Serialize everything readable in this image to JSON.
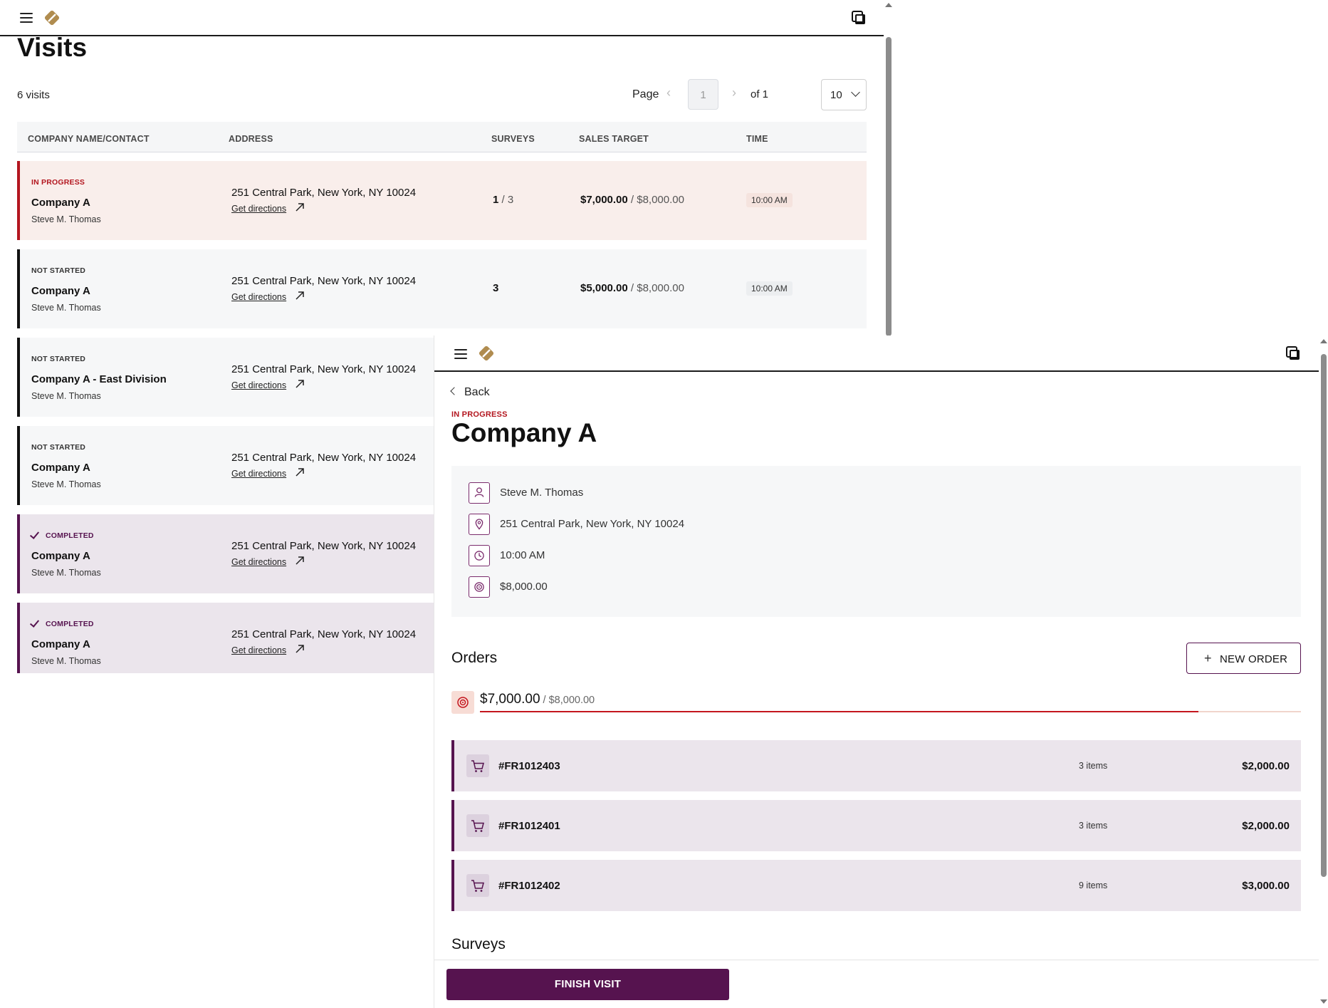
{
  "colors": {
    "brand_purple": "#56134f",
    "in_progress_red": "#b3161f",
    "logo_gold": "#b08c4f"
  },
  "list_view": {
    "title": "Visits",
    "count_text": "6 visits",
    "pagination": {
      "page_label": "Page",
      "current_page": "1",
      "of_text": "of 1",
      "per_page": "10"
    },
    "columns": [
      "COMPANY NAME/CONTACT",
      "ADDRESS",
      "SURVEYS",
      "SALES TARGET",
      "TIME"
    ],
    "rows": [
      {
        "status": "IN PROGRESS",
        "company": "Company A",
        "contact": "Steve M. Thomas",
        "address": "251 Central Park, New York, NY 10024",
        "directions": "Get directions",
        "surveys_done": "1",
        "surveys_total": " / 3",
        "sales_amount": "$7,000.00",
        "sales_target": " / $8,000.00",
        "time": "10:00 AM"
      },
      {
        "status": "NOT STARTED",
        "company": "Company A",
        "contact": "Steve M. Thomas",
        "address": "251 Central Park, New York, NY 10024",
        "directions": "Get directions",
        "surveys_done": "3",
        "surveys_total": "",
        "sales_amount": "$5,000.00",
        "sales_target": " / $8,000.00",
        "time": "10:00 AM"
      },
      {
        "status": "NOT STARTED",
        "company": "Company A - East Division",
        "contact": "Steve M. Thomas",
        "address": "251 Central Park, New York, NY 10024",
        "directions": "Get directions"
      },
      {
        "status": "NOT STARTED",
        "company": "Company A",
        "contact": "Steve M. Thomas",
        "address": "251 Central Park, New York, NY 10024",
        "directions": "Get directions"
      },
      {
        "status": "COMPLETED",
        "company": "Company A",
        "contact": "Steve M. Thomas",
        "address": "251 Central Park, New York, NY 10024",
        "directions": "Get directions"
      },
      {
        "status": "COMPLETED",
        "company": "Company A",
        "contact": "Steve M. Thomas",
        "address": "251 Central Park, New York, NY 10024",
        "directions": "Get directions"
      }
    ]
  },
  "detail_view": {
    "back_label": "Back",
    "status": "IN PROGRESS",
    "title": "Company A",
    "info": {
      "contact": "Steve M. Thomas",
      "address": "251 Central Park, New York, NY 10024",
      "time": "10:00 AM",
      "target": "$8,000.00"
    },
    "orders_heading": "Orders",
    "new_order_label": "NEW ORDER",
    "progress": {
      "amount": "$7,000.00",
      "target": " / $8,000.00",
      "fraction": 0.875
    },
    "orders": [
      {
        "number": "#FR1012403",
        "items": "3 items",
        "amount": "$2,000.00"
      },
      {
        "number": "#FR1012401",
        "items": "3 items",
        "amount": "$2,000.00"
      },
      {
        "number": "#FR1012402",
        "items": "9 items",
        "amount": "$3,000.00"
      }
    ],
    "surveys_heading": "Surveys",
    "finish_label": "FINISH VISIT"
  }
}
